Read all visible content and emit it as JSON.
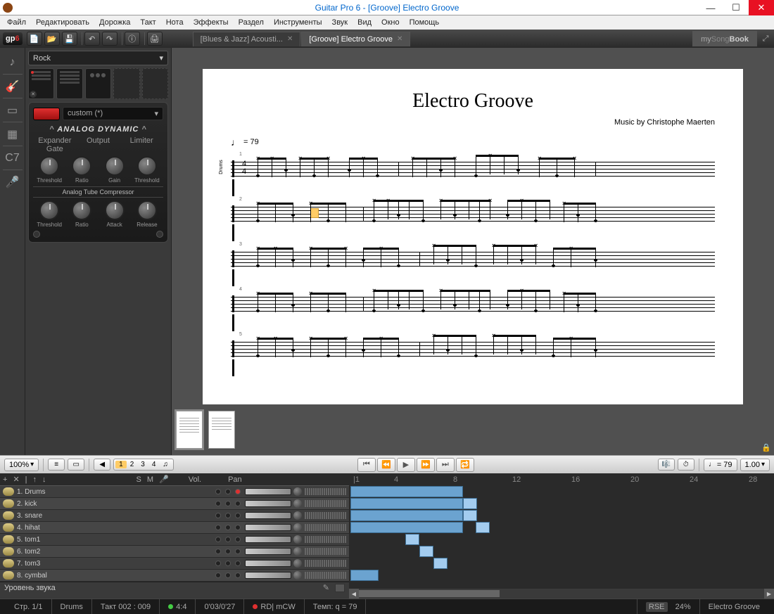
{
  "titlebar": {
    "title": "Guitar Pro 6 - [Groove] Electro Groove"
  },
  "winbuttons": {
    "min": "—",
    "max": "☐",
    "close": "✕"
  },
  "menu": {
    "items": [
      "Файл",
      "Редактировать",
      "Дорожка",
      "Такт",
      "Нота",
      "Эффекты",
      "Раздел",
      "Инструменты",
      "Звук",
      "Вид",
      "Окно",
      "Помощь"
    ]
  },
  "toolbar": {
    "logo": "gp",
    "logo_suffix": "6"
  },
  "tabs": [
    {
      "label": "[Blues & Jazz] Acousti...",
      "active": false
    },
    {
      "label": "[Groove] Electro Groove",
      "active": true
    }
  ],
  "brand": {
    "my": "my",
    "song": "Song",
    "book": "Book"
  },
  "leftbar": {
    "items": [
      "♪",
      "🎸",
      "▭",
      "▦",
      "C7",
      "🎤"
    ]
  },
  "sidepanel": {
    "style": "Rock",
    "effect": {
      "preset": "custom (*)",
      "title": "ANALOG DYNAMIC",
      "sections": [
        "Expander Gate",
        "Output",
        "Limiter"
      ],
      "knobs1": [
        "Threshold",
        "Ratio",
        "Gain",
        "Threshold"
      ],
      "section2": "Analog Tube Compressor",
      "knobs2": [
        "Threshold",
        "Ratio",
        "Attack",
        "Release"
      ]
    }
  },
  "score": {
    "title": "Electro Groove",
    "credit": "Music by Christophe Maerten",
    "tempo": "= 79",
    "track_label": "Drums",
    "timesig": {
      "top": "4",
      "bot": "4"
    },
    "measures": [
      "1",
      "2",
      "3",
      "4",
      "5"
    ]
  },
  "controlbar": {
    "zoom": "100%",
    "nums": [
      "1",
      "2",
      "3",
      "4"
    ],
    "tempo_display": "= 79",
    "speed": "1.00"
  },
  "mixer": {
    "header": {
      "add": "+",
      "remove": "✕",
      "sep": "|",
      "up": "↑",
      "down": "↓",
      "s": "S",
      "m": "M",
      "mic": "🎤",
      "vol": "Vol.",
      "pan": "Pan"
    },
    "ruler": [
      "|1",
      "4",
      "8",
      "12",
      "16",
      "20",
      "24",
      "28"
    ],
    "tracks": [
      {
        "num": "1.",
        "name": "Drums"
      },
      {
        "num": "2.",
        "name": "kick"
      },
      {
        "num": "3.",
        "name": "snare"
      },
      {
        "num": "4.",
        "name": "hihat"
      },
      {
        "num": "5.",
        "name": "tom1"
      },
      {
        "num": "6.",
        "name": "tom2"
      },
      {
        "num": "7.",
        "name": "tom3"
      },
      {
        "num": "8.",
        "name": "cymbal"
      }
    ],
    "soundlevel": "Уровень звука"
  },
  "status": {
    "page": "Стр. 1/1",
    "track": "Drums",
    "bar": "Такт 002 : 009",
    "sig": "4:4",
    "time": "0'03/0'27",
    "rd": "RD| mCW",
    "tempo": "Темп: q = 79",
    "rse": "RSE",
    "pct": "24%",
    "song": "Electro Groove"
  }
}
